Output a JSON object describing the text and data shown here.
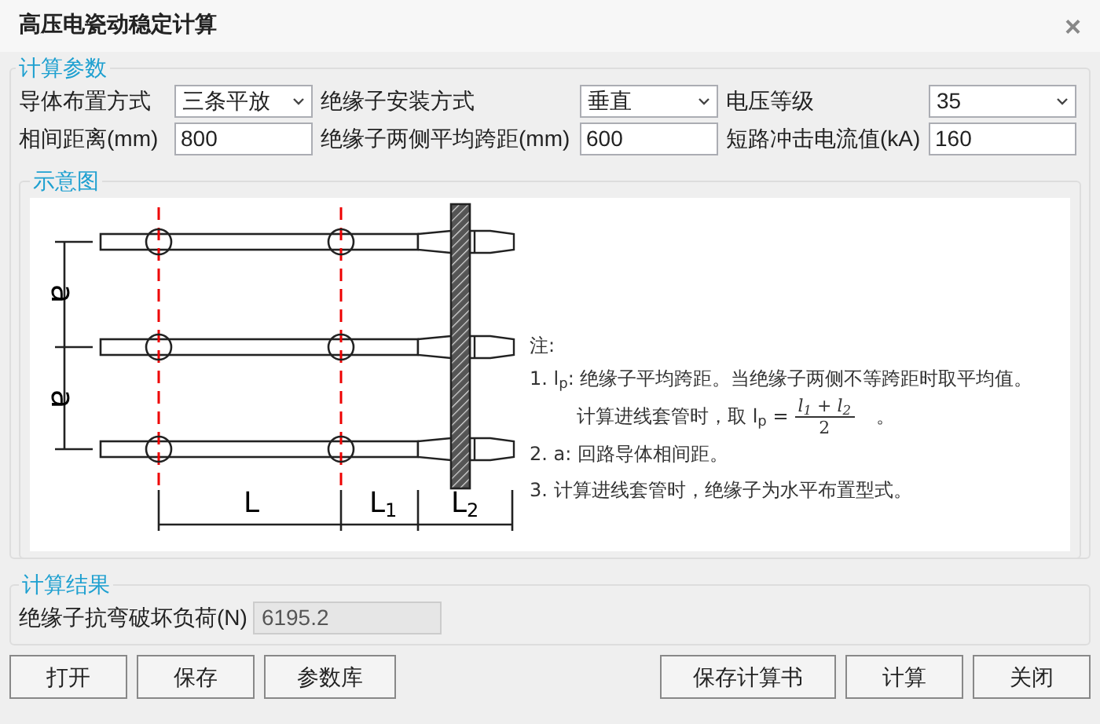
{
  "window": {
    "title": "高压电瓷动稳定计算",
    "close": "×"
  },
  "params": {
    "legend": "计算参数",
    "fields": [
      {
        "kind": "select",
        "label": "导体布置方式",
        "value": "三条平放"
      },
      {
        "kind": "select",
        "label": "绝缘子安装方式",
        "value": "垂直"
      },
      {
        "kind": "select",
        "label": "电压等级",
        "value": "35"
      },
      {
        "kind": "input",
        "label": "相间距离(mm)",
        "value": "800"
      },
      {
        "kind": "input",
        "label": "绝缘子两侧平均跨距(mm)",
        "value": "600"
      },
      {
        "kind": "input",
        "label": "短路冲击电流值(kA)",
        "value": "160"
      }
    ]
  },
  "diagram": {
    "legend": "示意图",
    "phase_labels": [
      "a",
      "a"
    ],
    "span_labels": [
      {
        "main": "L"
      },
      {
        "main": "L",
        "sub": "1"
      },
      {
        "main": "L",
        "sub": "2"
      }
    ],
    "notes": {
      "heading": "注:",
      "line_1": "1. l$_{p}$:  绝缘子平均跨距。当绝缘子两侧不等跨距时取平均值。",
      "line_1b": "计算进线套管时，取  l$_{p}$ =",
      "numerator": "l$_{1}$ + l$_{2}$",
      "denominator": "2",
      "line_1b_end": "。",
      "line_2": "2. a:  回路导体相间距。",
      "line_3": "3. 计算进线套管时，绝缘子为水平布置型式。"
    }
  },
  "result": {
    "legend": "计算结果",
    "label": "绝缘子抗弯破坏负荷(N)",
    "value": "6195.2",
    "disabled": true
  },
  "buttons_left": [
    "打开",
    "保存",
    "参数库"
  ],
  "buttons_right": [
    "保存计算书",
    "计算",
    "关闭"
  ]
}
